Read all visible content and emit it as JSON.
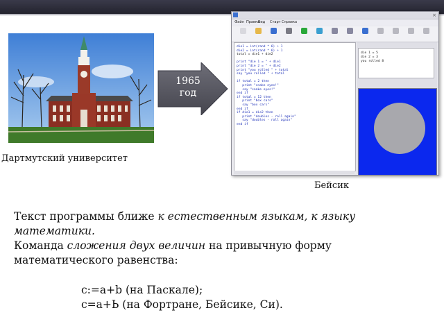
{
  "slide": {
    "photo_caption": "Дартмутский университет",
    "arrow_label_line1": "1965",
    "arrow_label_line2": "год",
    "ide_caption": "Бейсик"
  },
  "ide": {
    "menu": [
      "Файл",
      "Правка",
      "Вид",
      "Старт",
      "Справка"
    ],
    "toolbar": [
      {
        "icon": "new-file-icon",
        "color": "#d8d8de"
      },
      {
        "icon": "open-folder-icon",
        "color": "#e6b84a"
      },
      {
        "icon": "save-icon",
        "color": "#3a6fd0"
      },
      {
        "icon": "print-icon",
        "color": "#7a7a84"
      },
      {
        "icon": "run-icon",
        "color": "#2aa83a"
      },
      {
        "icon": "step-icon",
        "color": "#3a9fd0"
      },
      {
        "icon": "pause-icon",
        "color": "#8888a0"
      },
      {
        "icon": "stop-icon",
        "color": "#8888a0"
      },
      {
        "icon": "undo-icon",
        "color": "#3a6fd0"
      },
      {
        "icon": "redo-icon",
        "color": "#b8b8c0"
      },
      {
        "icon": "cut-icon",
        "color": "#b8b8c0"
      },
      {
        "icon": "copy-icon",
        "color": "#b8b8c0"
      },
      {
        "icon": "paste-icon",
        "color": "#b8b8c0"
      }
    ],
    "code_lines": [
      "die1 = int(rand * 6) + 1",
      "die2 = int(rand * 6) + 1",
      "total = die1 + die2",
      "",
      "print \"die 1 = \" + die1",
      "print \"die 2 = \" + die2",
      "print \"you rolled \" + total",
      "say \"you rolled \" + total",
      "",
      "if total = 2 then",
      "   print \"snake eyes!\"",
      "   say \"snake eyes!\"",
      "end if",
      "if total = 12 then",
      "   print \"box cars\"",
      "   say \"box cars\"",
      "end if",
      "if die1 = die2 then",
      "   print \"doubles - roll again\"",
      "   say \"doubles - roll again\"",
      "end if"
    ],
    "output_lines": [
      "die 1 = 5",
      "die 2 = 3",
      "you rolled 8"
    ],
    "colors": {
      "graphics_bg": "#0b28ee",
      "circle": "#a8a8ad"
    }
  },
  "text": {
    "p1_normal": "Текст программы ближе ",
    "p1_italic": "к естественным языкам, к языку",
    "p2_italic": "математики.",
    "p3_normal": "Команда ",
    "p3_italic": "сложения двух величин",
    "p3_end": " на привычную форму",
    "p4": "математического равенства:",
    "ex1": "c:=a+b (на Паскале);",
    "ex2": "c=a+Ь (на Фортране, Бейсике, Си)."
  }
}
